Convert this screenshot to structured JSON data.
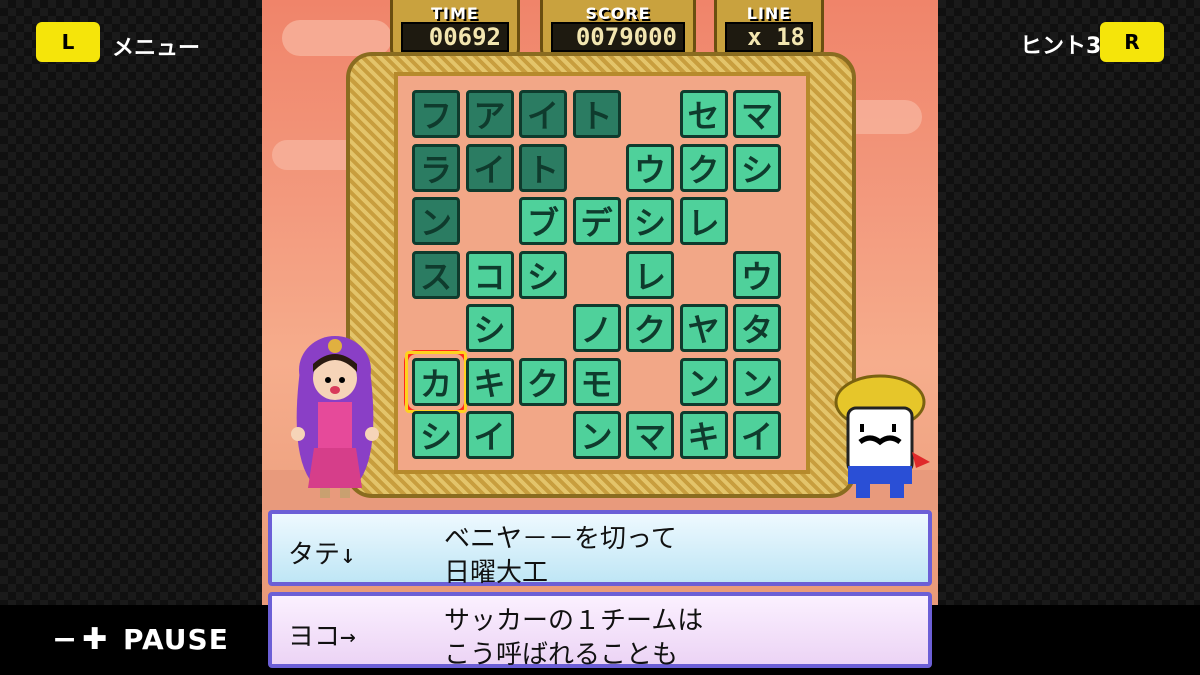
{
  "left_panel": {
    "l_button": "L",
    "menu_label": "メニュー"
  },
  "right_panel": {
    "hint_label": "ヒント3",
    "r_button": "R"
  },
  "pause": {
    "label": "PAUSE",
    "minus": "−",
    "plus": "✚"
  },
  "hud": {
    "time": {
      "label": "TIME",
      "value": "00692"
    },
    "score": {
      "label": "SCORE",
      "value": "0079000"
    },
    "line": {
      "label": "LINE",
      "value": "x 18"
    }
  },
  "board": {
    "rows": 7,
    "cols": 7,
    "cells": [
      {
        "r": 0,
        "c": 0,
        "ch": "フ",
        "style": "dark"
      },
      {
        "r": 0,
        "c": 1,
        "ch": "ア",
        "style": "dark"
      },
      {
        "r": 0,
        "c": 2,
        "ch": "イ",
        "style": "dark"
      },
      {
        "r": 0,
        "c": 3,
        "ch": "ト",
        "style": "dark"
      },
      {
        "r": 0,
        "c": 5,
        "ch": "セ",
        "style": "light"
      },
      {
        "r": 0,
        "c": 6,
        "ch": "マ",
        "style": "light"
      },
      {
        "r": 1,
        "c": 0,
        "ch": "ラ",
        "style": "dark"
      },
      {
        "r": 1,
        "c": 1,
        "ch": "イ",
        "style": "dark"
      },
      {
        "r": 1,
        "c": 2,
        "ch": "ト",
        "style": "dark"
      },
      {
        "r": 1,
        "c": 4,
        "ch": "ウ",
        "style": "light"
      },
      {
        "r": 1,
        "c": 5,
        "ch": "ク",
        "style": "light"
      },
      {
        "r": 1,
        "c": 6,
        "ch": "シ",
        "style": "light"
      },
      {
        "r": 2,
        "c": 0,
        "ch": "ン",
        "style": "dark"
      },
      {
        "r": 2,
        "c": 2,
        "ch": "ブ",
        "style": "light"
      },
      {
        "r": 2,
        "c": 3,
        "ch": "デ",
        "style": "light"
      },
      {
        "r": 2,
        "c": 4,
        "ch": "シ",
        "style": "light"
      },
      {
        "r": 2,
        "c": 5,
        "ch": "レ",
        "style": "light"
      },
      {
        "r": 3,
        "c": 0,
        "ch": "ス",
        "style": "dark"
      },
      {
        "r": 3,
        "c": 1,
        "ch": "コ",
        "style": "light"
      },
      {
        "r": 3,
        "c": 2,
        "ch": "シ",
        "style": "light"
      },
      {
        "r": 3,
        "c": 4,
        "ch": "レ",
        "style": "light"
      },
      {
        "r": 3,
        "c": 6,
        "ch": "ウ",
        "style": "light"
      },
      {
        "r": 4,
        "c": 1,
        "ch": "シ",
        "style": "light"
      },
      {
        "r": 4,
        "c": 3,
        "ch": "ノ",
        "style": "light"
      },
      {
        "r": 4,
        "c": 4,
        "ch": "ク",
        "style": "light"
      },
      {
        "r": 4,
        "c": 5,
        "ch": "ヤ",
        "style": "light"
      },
      {
        "r": 4,
        "c": 6,
        "ch": "タ",
        "style": "light"
      },
      {
        "r": 5,
        "c": 0,
        "ch": "カ",
        "style": "light",
        "selected": true
      },
      {
        "r": 5,
        "c": 1,
        "ch": "キ",
        "style": "light"
      },
      {
        "r": 5,
        "c": 2,
        "ch": "ク",
        "style": "light"
      },
      {
        "r": 5,
        "c": 3,
        "ch": "モ",
        "style": "light"
      },
      {
        "r": 5,
        "c": 5,
        "ch": "ン",
        "style": "light"
      },
      {
        "r": 5,
        "c": 6,
        "ch": "ン",
        "style": "light"
      },
      {
        "r": 6,
        "c": 0,
        "ch": "シ",
        "style": "light"
      },
      {
        "r": 6,
        "c": 1,
        "ch": "イ",
        "style": "light"
      },
      {
        "r": 6,
        "c": 3,
        "ch": "ン",
        "style": "light"
      },
      {
        "r": 6,
        "c": 4,
        "ch": "マ",
        "style": "light"
      },
      {
        "r": 6,
        "c": 5,
        "ch": "キ",
        "style": "light"
      },
      {
        "r": 6,
        "c": 6,
        "ch": "イ",
        "style": "light"
      }
    ]
  },
  "clues": {
    "tate": {
      "direction": "タテ↓",
      "line1": "ベニヤ－－を切って",
      "line2": "日曜大工"
    },
    "yoko": {
      "direction": "ヨコ→",
      "line1": "サッカーの１チームは",
      "line2": "こう呼ばれることも"
    }
  },
  "colors": {
    "accent_yellow": "#f5e50a",
    "tile_light": "#4fd19b",
    "tile_dark": "#2b7c62",
    "select": "#ff2a1a"
  }
}
